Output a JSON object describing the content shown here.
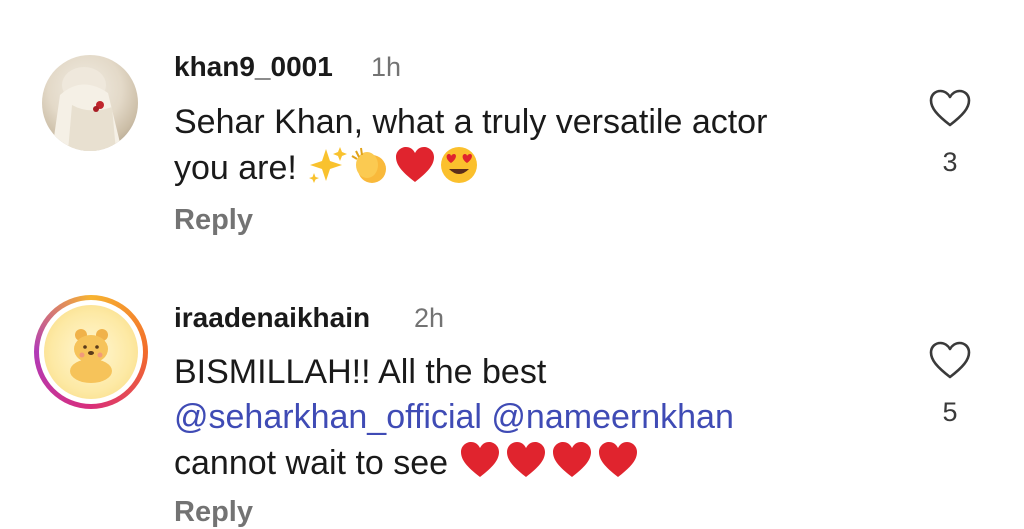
{
  "comments": [
    {
      "username": "khan9_0001",
      "time": "1h",
      "text_line1": "Sehar Khan, what a truly versatile actor",
      "text_line2": "you are!",
      "emojis": [
        "sparkles-emoji",
        "clapping-hands-emoji",
        "red-heart-emoji",
        "heart-eyes-emoji"
      ],
      "reply_label": "Reply",
      "like_count": "3"
    },
    {
      "username": "iraadenaikhain",
      "time": "2h",
      "text_line1": "BISMILLAH!! All the best",
      "mention1": "@seharkhan_official",
      "mention2": "@nameernkhan",
      "text_line3": "cannot wait to see",
      "emojis": [
        "red-heart-emoji",
        "red-heart-emoji",
        "red-heart-emoji",
        "red-heart-emoji"
      ],
      "reply_label": "Reply",
      "like_count": "5"
    }
  ],
  "colors": {
    "mention": "#3f4bb5",
    "secondary_text": "#737373",
    "heart_red": "#e0242e"
  }
}
